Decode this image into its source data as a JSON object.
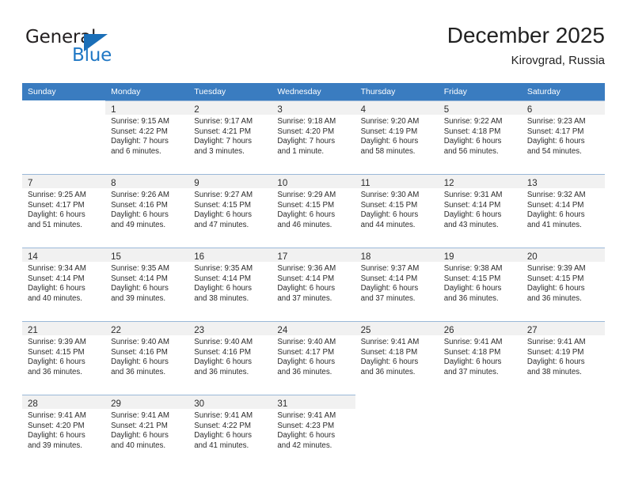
{
  "brand": {
    "name_part1": "General",
    "name_part2": "Blue",
    "accent_color": "#1b6fb8",
    "logo_icon": "triangle-flag-icon"
  },
  "header": {
    "title": "December 2025",
    "location": "Kirovgrad, Russia"
  },
  "calendar": {
    "weekday_headers": [
      "Sunday",
      "Monday",
      "Tuesday",
      "Wednesday",
      "Thursday",
      "Friday",
      "Saturday"
    ],
    "header_bg": "#3a7cc0",
    "daynum_bg": "#f1f1f1",
    "weeks": [
      [
        {
          "day": "",
          "lines": []
        },
        {
          "day": "1",
          "lines": [
            "Sunrise: 9:15 AM",
            "Sunset: 4:22 PM",
            "Daylight: 7 hours",
            "and 6 minutes."
          ]
        },
        {
          "day": "2",
          "lines": [
            "Sunrise: 9:17 AM",
            "Sunset: 4:21 PM",
            "Daylight: 7 hours",
            "and 3 minutes."
          ]
        },
        {
          "day": "3",
          "lines": [
            "Sunrise: 9:18 AM",
            "Sunset: 4:20 PM",
            "Daylight: 7 hours",
            "and 1 minute."
          ]
        },
        {
          "day": "4",
          "lines": [
            "Sunrise: 9:20 AM",
            "Sunset: 4:19 PM",
            "Daylight: 6 hours",
            "and 58 minutes."
          ]
        },
        {
          "day": "5",
          "lines": [
            "Sunrise: 9:22 AM",
            "Sunset: 4:18 PM",
            "Daylight: 6 hours",
            "and 56 minutes."
          ]
        },
        {
          "day": "6",
          "lines": [
            "Sunrise: 9:23 AM",
            "Sunset: 4:17 PM",
            "Daylight: 6 hours",
            "and 54 minutes."
          ]
        }
      ],
      [
        {
          "day": "7",
          "lines": [
            "Sunrise: 9:25 AM",
            "Sunset: 4:17 PM",
            "Daylight: 6 hours",
            "and 51 minutes."
          ]
        },
        {
          "day": "8",
          "lines": [
            "Sunrise: 9:26 AM",
            "Sunset: 4:16 PM",
            "Daylight: 6 hours",
            "and 49 minutes."
          ]
        },
        {
          "day": "9",
          "lines": [
            "Sunrise: 9:27 AM",
            "Sunset: 4:15 PM",
            "Daylight: 6 hours",
            "and 47 minutes."
          ]
        },
        {
          "day": "10",
          "lines": [
            "Sunrise: 9:29 AM",
            "Sunset: 4:15 PM",
            "Daylight: 6 hours",
            "and 46 minutes."
          ]
        },
        {
          "day": "11",
          "lines": [
            "Sunrise: 9:30 AM",
            "Sunset: 4:15 PM",
            "Daylight: 6 hours",
            "and 44 minutes."
          ]
        },
        {
          "day": "12",
          "lines": [
            "Sunrise: 9:31 AM",
            "Sunset: 4:14 PM",
            "Daylight: 6 hours",
            "and 43 minutes."
          ]
        },
        {
          "day": "13",
          "lines": [
            "Sunrise: 9:32 AM",
            "Sunset: 4:14 PM",
            "Daylight: 6 hours",
            "and 41 minutes."
          ]
        }
      ],
      [
        {
          "day": "14",
          "lines": [
            "Sunrise: 9:34 AM",
            "Sunset: 4:14 PM",
            "Daylight: 6 hours",
            "and 40 minutes."
          ]
        },
        {
          "day": "15",
          "lines": [
            "Sunrise: 9:35 AM",
            "Sunset: 4:14 PM",
            "Daylight: 6 hours",
            "and 39 minutes."
          ]
        },
        {
          "day": "16",
          "lines": [
            "Sunrise: 9:35 AM",
            "Sunset: 4:14 PM",
            "Daylight: 6 hours",
            "and 38 minutes."
          ]
        },
        {
          "day": "17",
          "lines": [
            "Sunrise: 9:36 AM",
            "Sunset: 4:14 PM",
            "Daylight: 6 hours",
            "and 37 minutes."
          ]
        },
        {
          "day": "18",
          "lines": [
            "Sunrise: 9:37 AM",
            "Sunset: 4:14 PM",
            "Daylight: 6 hours",
            "and 37 minutes."
          ]
        },
        {
          "day": "19",
          "lines": [
            "Sunrise: 9:38 AM",
            "Sunset: 4:15 PM",
            "Daylight: 6 hours",
            "and 36 minutes."
          ]
        },
        {
          "day": "20",
          "lines": [
            "Sunrise: 9:39 AM",
            "Sunset: 4:15 PM",
            "Daylight: 6 hours",
            "and 36 minutes."
          ]
        }
      ],
      [
        {
          "day": "21",
          "lines": [
            "Sunrise: 9:39 AM",
            "Sunset: 4:15 PM",
            "Daylight: 6 hours",
            "and 36 minutes."
          ]
        },
        {
          "day": "22",
          "lines": [
            "Sunrise: 9:40 AM",
            "Sunset: 4:16 PM",
            "Daylight: 6 hours",
            "and 36 minutes."
          ]
        },
        {
          "day": "23",
          "lines": [
            "Sunrise: 9:40 AM",
            "Sunset: 4:16 PM",
            "Daylight: 6 hours",
            "and 36 minutes."
          ]
        },
        {
          "day": "24",
          "lines": [
            "Sunrise: 9:40 AM",
            "Sunset: 4:17 PM",
            "Daylight: 6 hours",
            "and 36 minutes."
          ]
        },
        {
          "day": "25",
          "lines": [
            "Sunrise: 9:41 AM",
            "Sunset: 4:18 PM",
            "Daylight: 6 hours",
            "and 36 minutes."
          ]
        },
        {
          "day": "26",
          "lines": [
            "Sunrise: 9:41 AM",
            "Sunset: 4:18 PM",
            "Daylight: 6 hours",
            "and 37 minutes."
          ]
        },
        {
          "day": "27",
          "lines": [
            "Sunrise: 9:41 AM",
            "Sunset: 4:19 PM",
            "Daylight: 6 hours",
            "and 38 minutes."
          ]
        }
      ],
      [
        {
          "day": "28",
          "lines": [
            "Sunrise: 9:41 AM",
            "Sunset: 4:20 PM",
            "Daylight: 6 hours",
            "and 39 minutes."
          ]
        },
        {
          "day": "29",
          "lines": [
            "Sunrise: 9:41 AM",
            "Sunset: 4:21 PM",
            "Daylight: 6 hours",
            "and 40 minutes."
          ]
        },
        {
          "day": "30",
          "lines": [
            "Sunrise: 9:41 AM",
            "Sunset: 4:22 PM",
            "Daylight: 6 hours",
            "and 41 minutes."
          ]
        },
        {
          "day": "31",
          "lines": [
            "Sunrise: 9:41 AM",
            "Sunset: 4:23 PM",
            "Daylight: 6 hours",
            "and 42 minutes."
          ]
        },
        {
          "day": "",
          "lines": []
        },
        {
          "day": "",
          "lines": []
        },
        {
          "day": "",
          "lines": []
        }
      ]
    ]
  }
}
